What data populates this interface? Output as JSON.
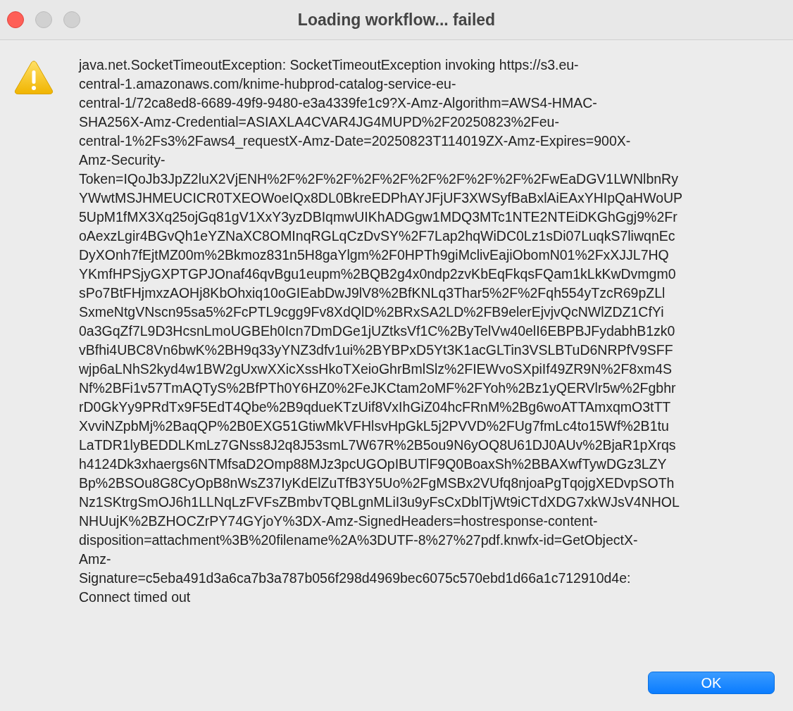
{
  "window": {
    "title": "Loading workflow... failed"
  },
  "message": "java.net.SocketTimeoutException: SocketTimeoutException invoking https://s3.eu-\ncentral-1.amazonaws.com/knime-hubprod-catalog-service-eu-\ncentral-1/72ca8ed8-6689-49f9-9480-e3a4339fe1c9?X-Amz-Algorithm=AWS4-HMAC-\nSHA256X-Amz-Credential=ASIAXLA4CVAR4JG4MUPD%2F20250823%2Feu-\ncentral-1%2Fs3%2Faws4_requestX-Amz-Date=20250823T114019ZX-Amz-Expires=900X-\nAmz-Security-\nToken=IQoJb3JpZ2luX2VjENH%2F%2F%2F%2F%2F%2F%2F%2F%2F%2FwEaDGV1LWNlbnRy\nYWwtMSJHMEUCICR0TXEOWoeIQx8DL0BkreEDPhAYJFjUF3XWSyfBaBxlAiEAxYHIpQaHWoUP\n5UpM1fMX3Xq25ojGq81gV1XxY3yzDBIqmwUIKhADGgw1MDQ3MTc1NTE2NTEiDKGhGgj9%2Fr\noAexzLgir4BGvQh1eYZNaXC8OMInqRGLqCzDvSY%2F7Lap2hqWiDC0Lz1sDi07LuqkS7liwqnEc\nDyXOnh7fEjtMZ00m%2Bkmoz831n5H8gaYlgm%2F0HPTh9giMclivEajiObomN01%2FxXJJL7HQ\nYKmfHPSjyGXPTGPJOnaf46qvBgu1eupm%2BQB2g4x0ndp2zvKbEqFkqsFQam1kLkKwDvmgm0\nsPo7BtFHjmxzAOHj8KbOhxiq10oGIEabDwJ9lV8%2BfKNLq3Thar5%2F%2Fqh554yTzcR69pZLl\nSxmeNtgVNscn95sa5%2FcPTL9cgg9Fv8XdQlD%2BRxSA2LD%2FB9elerEjvjvQcNWlZDZ1CfYi\n0a3GqZf7L9D3HcsnLmoUGBEh0Icn7DmDGe1jUZtksVf1C%2ByTelVw40elI6EBPBJFydabhB1zk0\nvBfhi4UBC8Vn6bwK%2BH9q33yYNZ3dfv1ui%2BYBPxD5Yt3K1acGLTin3VSLBTuD6NRPfV9SFF\nwjp6aLNhS2kyd4w1BW2gUxwXXicXssHkoTXeioGhrBmlSlz%2FIEWvoSXpiIf49ZR9N%2F8xm4S\nNf%2BFi1v57TmAQTyS%2BfPTh0Y6HZ0%2FeJKCtam2oMF%2FYoh%2Bz1yQERVlr5w%2Fgbhr\nrD0GkYy9PRdTx9F5EdT4Qbe%2B9qdueKTzUif8VxIhGiZ04hcFRnM%2Bg6woATTAmxqmO3tTT\nXvviNZpbMj%2BaqQP%2B0EXG51GtiwMkVFHlsvHpGkL5j2PVVD%2FUg7fmLc4to15Wf%2B1tu\nLaTDR1lyBEDDLKmLz7GNss8J2q8J53smL7W67R%2B5ou9N6yOQ8U61DJ0AUv%2BjaR1pXrqs\nh4124Dk3xhaergs6NTMfsaD2Omp88MJz3pcUGOpIBUTlF9Q0BoaxSh%2BBAXwfTywDGz3LZY\nBp%2BSOu8G8CyOpB8nWsZ37IyKdElZuTfB3Y5Uo%2FgMSBx2VUfq8njoaPgTqojgXEDvpSOTh\nNz1SKtrgSmOJ6h1LLNqLzFVFsZBmbvTQBLgnMLiI3u9yFsCxDblTjWt9iCTdXDG7xkWJsV4NHOL\nNHUujK%2BZHOCZrPY74GYjoY%3DX-Amz-SignedHeaders=hostresponse-content-\ndisposition=attachment%3B%20filename%2A%3DUTF-8%27%27pdf.knwfx-id=GetObjectX-\nAmz-\nSignature=c5eba491d3a6ca7b3a787b056f298d4969bec6075c570ebd1d66a1c712910d4e:\nConnect timed out",
  "buttons": [
    {
      "label": "OK",
      "default": true
    }
  ]
}
